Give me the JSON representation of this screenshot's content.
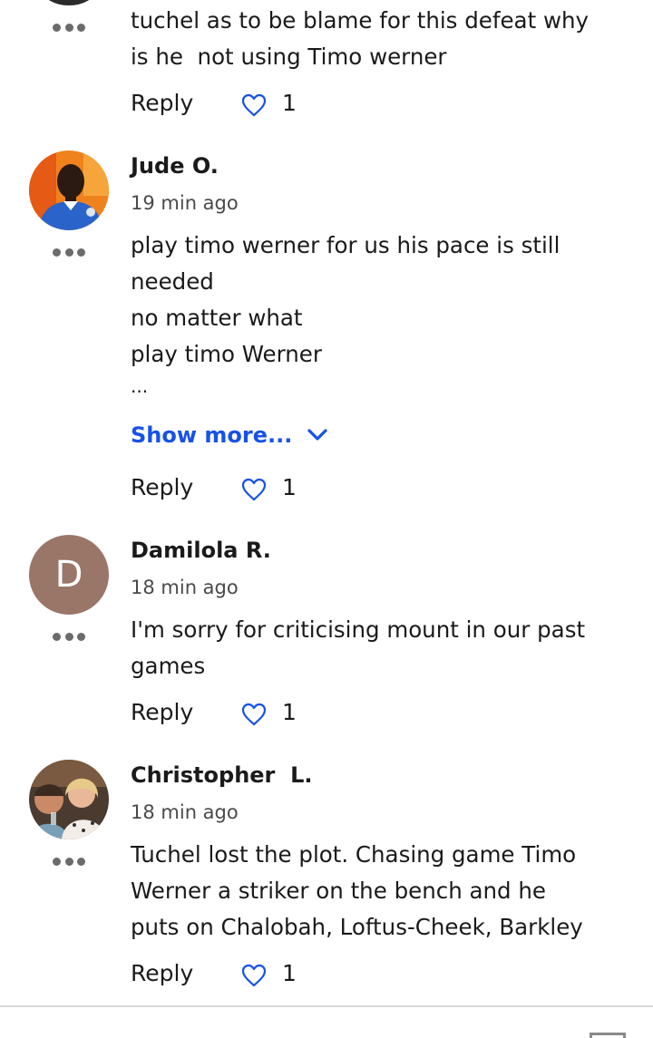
{
  "comments": [
    {
      "author": "",
      "time": "",
      "lines": [
        "tuchel as to be blame for this defeat why",
        "is he  not using Timo werner"
      ],
      "reply_label": "Reply",
      "likes": "1"
    },
    {
      "author": "Jude O.",
      "time": "19 min ago",
      "lines": [
        "play timo werner for us his pace is still",
        "needed",
        "no matter what",
        "play timo Werner",
        "..."
      ],
      "show_more_label": "Show more...",
      "reply_label": "Reply",
      "likes": "1"
    },
    {
      "author": "Damilola R.",
      "avatar_letter": "D",
      "time": "18 min ago",
      "lines": [
        "I'm sorry for criticising mount in our past",
        "games"
      ],
      "reply_label": "Reply",
      "likes": "1"
    },
    {
      "author": "Christopher  L.",
      "time": "18 min ago",
      "lines": [
        "Tuchel lost the plot. Chasing game Timo",
        "Werner a striker on the bench and he",
        "puts on Chalobah, Loftus-Cheek, Barkley"
      ],
      "reply_label": "Reply",
      "likes": "1"
    }
  ],
  "icons": {
    "more": "more-options-icon",
    "like": "heart-outline-icon",
    "show_more": "chevron-down-icon"
  },
  "colors": {
    "link": "#1752e6",
    "heart": "#1752e6",
    "avatar_letter_bg": "#9a7668"
  }
}
